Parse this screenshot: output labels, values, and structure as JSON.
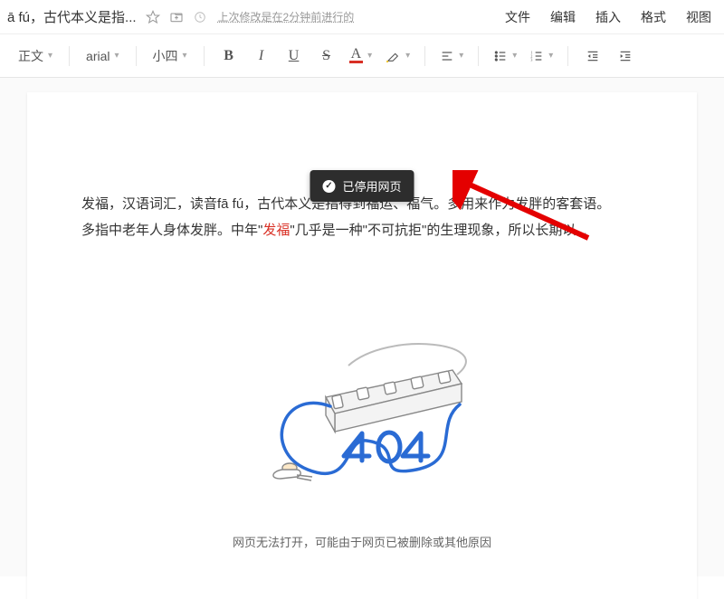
{
  "header": {
    "title": "ā fú，古代本义是指...",
    "last_modified": "上次修改是在2分钟前进行的"
  },
  "menu": {
    "file": "文件",
    "edit": "编辑",
    "insert": "插入",
    "format": "格式",
    "view": "视图"
  },
  "toolbar": {
    "paragraph": "正文",
    "font": "arial",
    "size": "小四",
    "bold": "B",
    "italic": "I",
    "underline": "U",
    "strike": "S",
    "textcolor_letter": "A"
  },
  "toast": {
    "text": "已停用网页"
  },
  "doc": {
    "line1_a": "发福，汉语词汇，读音fā fú，古代本义是指得到福运、福气。多用来作为发胖的客套语。",
    "line2_a": "多指中老年人身体发胖。中年\"",
    "highlight": "发福",
    "line2_b": "\"几乎是一种\"不可抗拒\"的生理现象，所以长期以",
    "ellipsis": "..."
  },
  "error": {
    "footer": "网页无法打开，可能由于网页已被删除或其他原因"
  }
}
